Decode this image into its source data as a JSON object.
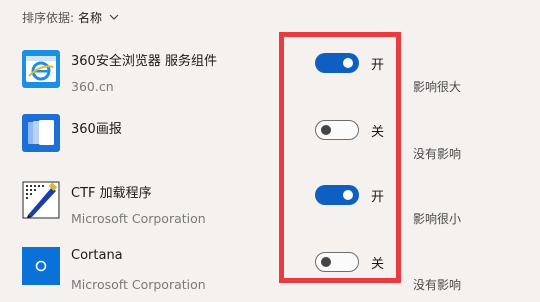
{
  "sort": {
    "label": "排序依据:",
    "value": "名称"
  },
  "apps": [
    {
      "name": "360安全浏览器 服务组件",
      "publisher": "360.cn",
      "enabled": true,
      "state_label": "开",
      "impact": "影响很大",
      "icon": "360-browser-icon"
    },
    {
      "name": "360画报",
      "publisher": "",
      "enabled": false,
      "state_label": "关",
      "impact": "没有影响",
      "icon": "360-wallpaper-icon"
    },
    {
      "name": "CTF 加载程序",
      "publisher": "Microsoft Corporation",
      "enabled": true,
      "state_label": "开",
      "impact": "影响很小",
      "icon": "ctf-loader-icon"
    },
    {
      "name": "Cortana",
      "publisher": "Microsoft Corporation",
      "enabled": false,
      "state_label": "关",
      "impact": "没有影响",
      "icon": "cortana-icon"
    }
  ],
  "colors": {
    "toggle_on": "#0f5fc2",
    "highlight": "#e83a3f",
    "background": "#f4f1ee"
  }
}
